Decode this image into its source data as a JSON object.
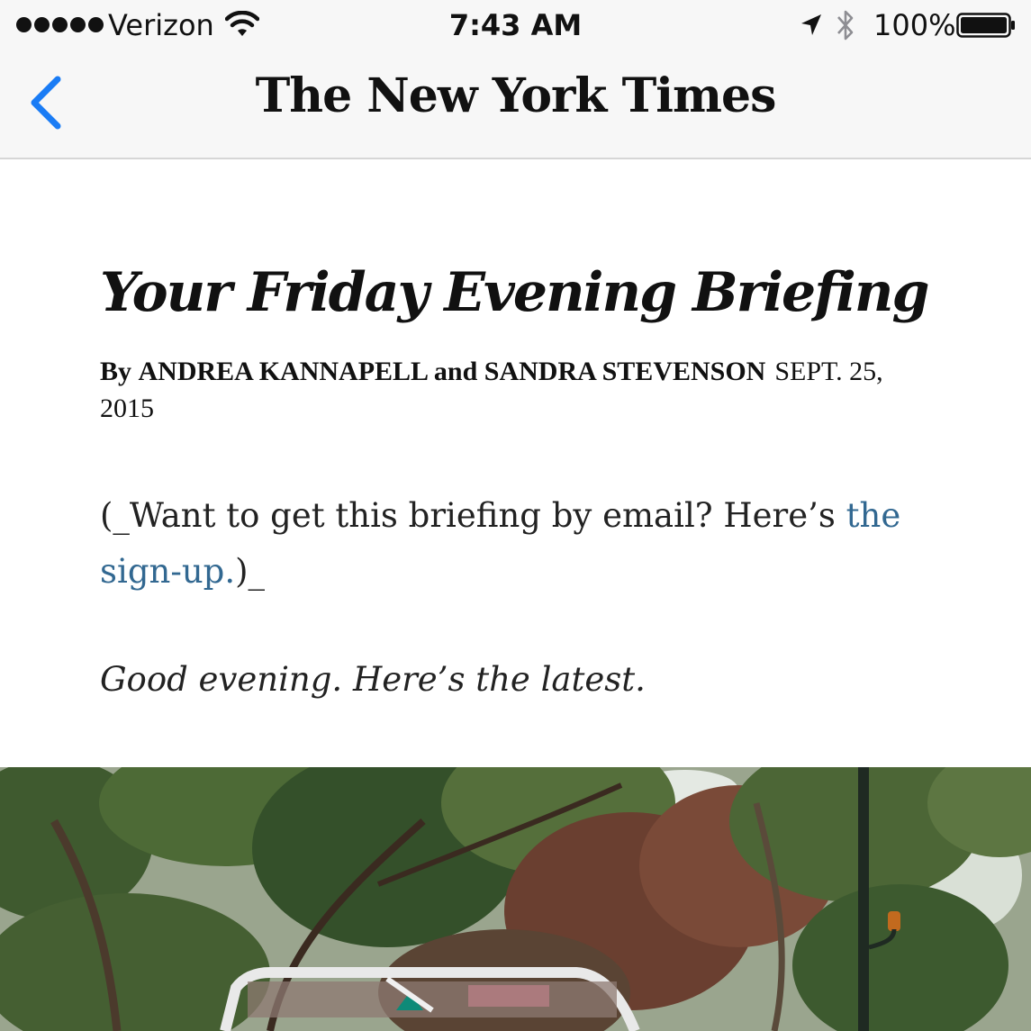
{
  "status_bar": {
    "carrier": "Verizon",
    "time": "7:43 AM",
    "battery_percent": "100%",
    "signal_bars": 5,
    "icons": [
      "signal-dots-icon",
      "wifi-icon",
      "location-arrow-icon",
      "bluetooth-icon",
      "battery-icon"
    ]
  },
  "nav": {
    "back_icon": "chevron-left-icon",
    "logo_text": "The New York Times",
    "accent_color": "#1a7cf5"
  },
  "article": {
    "headline": "Your Friday Evening Briefing",
    "byline_prefix": "By",
    "byline_authors": "ANDREA KANNAPELL and SANDRA STEVENSON",
    "date": "SEPT. 25, 2015",
    "promo_before": "(_Want to get this briefing by email? Here’s ",
    "promo_link": "the sign-up.",
    "promo_after": ")_",
    "link_color": "#326891",
    "intro": "Good evening. Here’s the latest."
  }
}
